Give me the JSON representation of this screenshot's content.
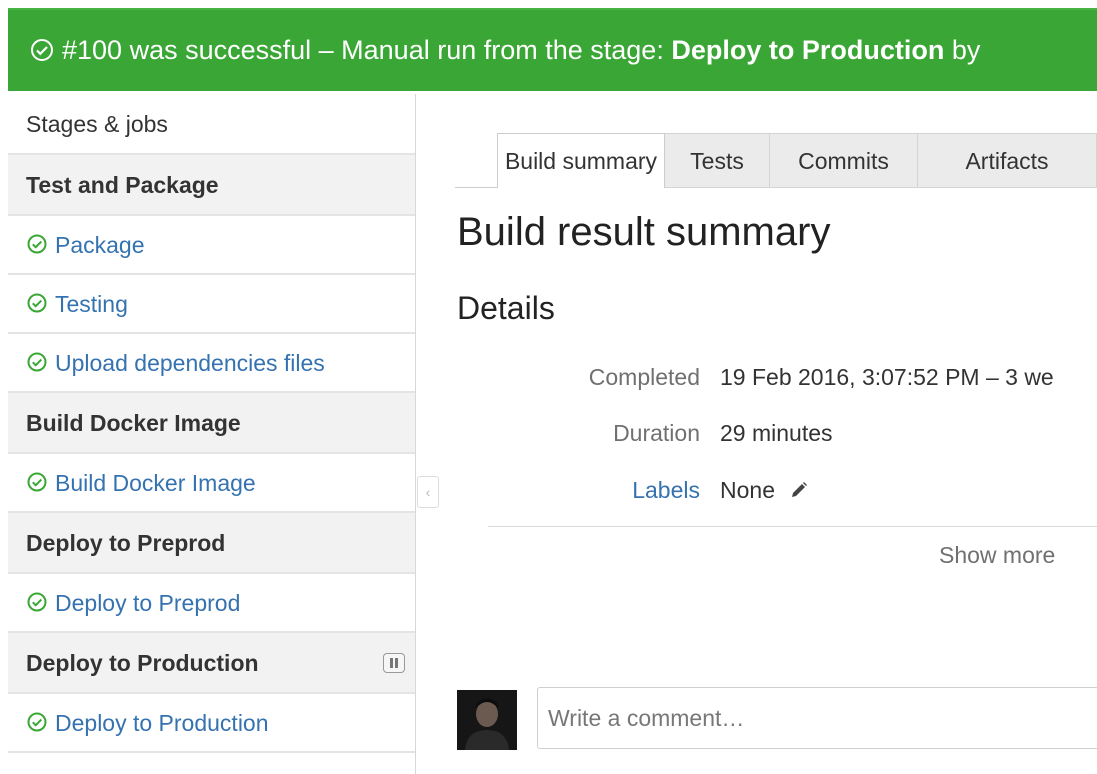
{
  "banner": {
    "result": "#100 was successful",
    "middle": " – Manual run from the stage: ",
    "stage": "Deploy to Production",
    "by": " by"
  },
  "sidebar": {
    "title": "Stages & jobs",
    "stages": [
      {
        "name": "Test and Package",
        "jobs": [
          "Package",
          "Testing",
          "Upload dependencies files"
        ]
      },
      {
        "name": "Build Docker Image",
        "jobs": [
          "Build Docker Image"
        ]
      },
      {
        "name": "Deploy to Preprod",
        "jobs": [
          "Deploy to Preprod"
        ]
      },
      {
        "name": "Deploy to Production",
        "jobs": [
          "Deploy to Production"
        ]
      }
    ]
  },
  "tabs": [
    "Build summary",
    "Tests",
    "Commits",
    "Artifacts"
  ],
  "active_tab": "Build summary",
  "main": {
    "title": "Build result summary",
    "details_heading": "Details",
    "completed_label": "Completed",
    "completed_value": "19 Feb 2016, 3:07:52 PM – 3 we",
    "duration_label": "Duration",
    "duration_value": "29 minutes",
    "labels_label": "Labels",
    "labels_value": "None",
    "show_more": "Show more"
  },
  "comment": {
    "placeholder": "Write a comment…"
  },
  "colors": {
    "success": "#3aa635",
    "link": "#3572b0"
  },
  "icons": [
    "check-circle-icon",
    "pause-icon",
    "pencil-icon",
    "collapse-arrow-icon",
    "avatar"
  ]
}
